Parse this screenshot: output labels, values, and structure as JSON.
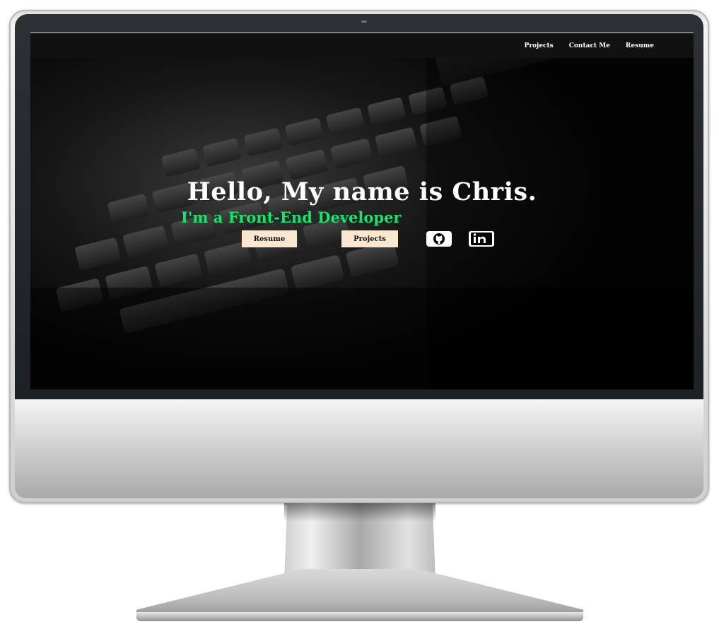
{
  "navbar": {
    "links": [
      "Projects",
      "Contact Me",
      "Resume"
    ]
  },
  "hero": {
    "title": "Hello, My name is Chris.",
    "subtitle": "I'm a Front-End Developer",
    "buttons": {
      "resume": "Resume",
      "projects": "Projects"
    },
    "social_icons": [
      "github-icon",
      "linkedin-icon"
    ]
  },
  "colors": {
    "accent_green": "#19e36b",
    "button_bg": "#fbe6cf",
    "navbar_bg": "#111111",
    "hero_bg": "#050505"
  }
}
